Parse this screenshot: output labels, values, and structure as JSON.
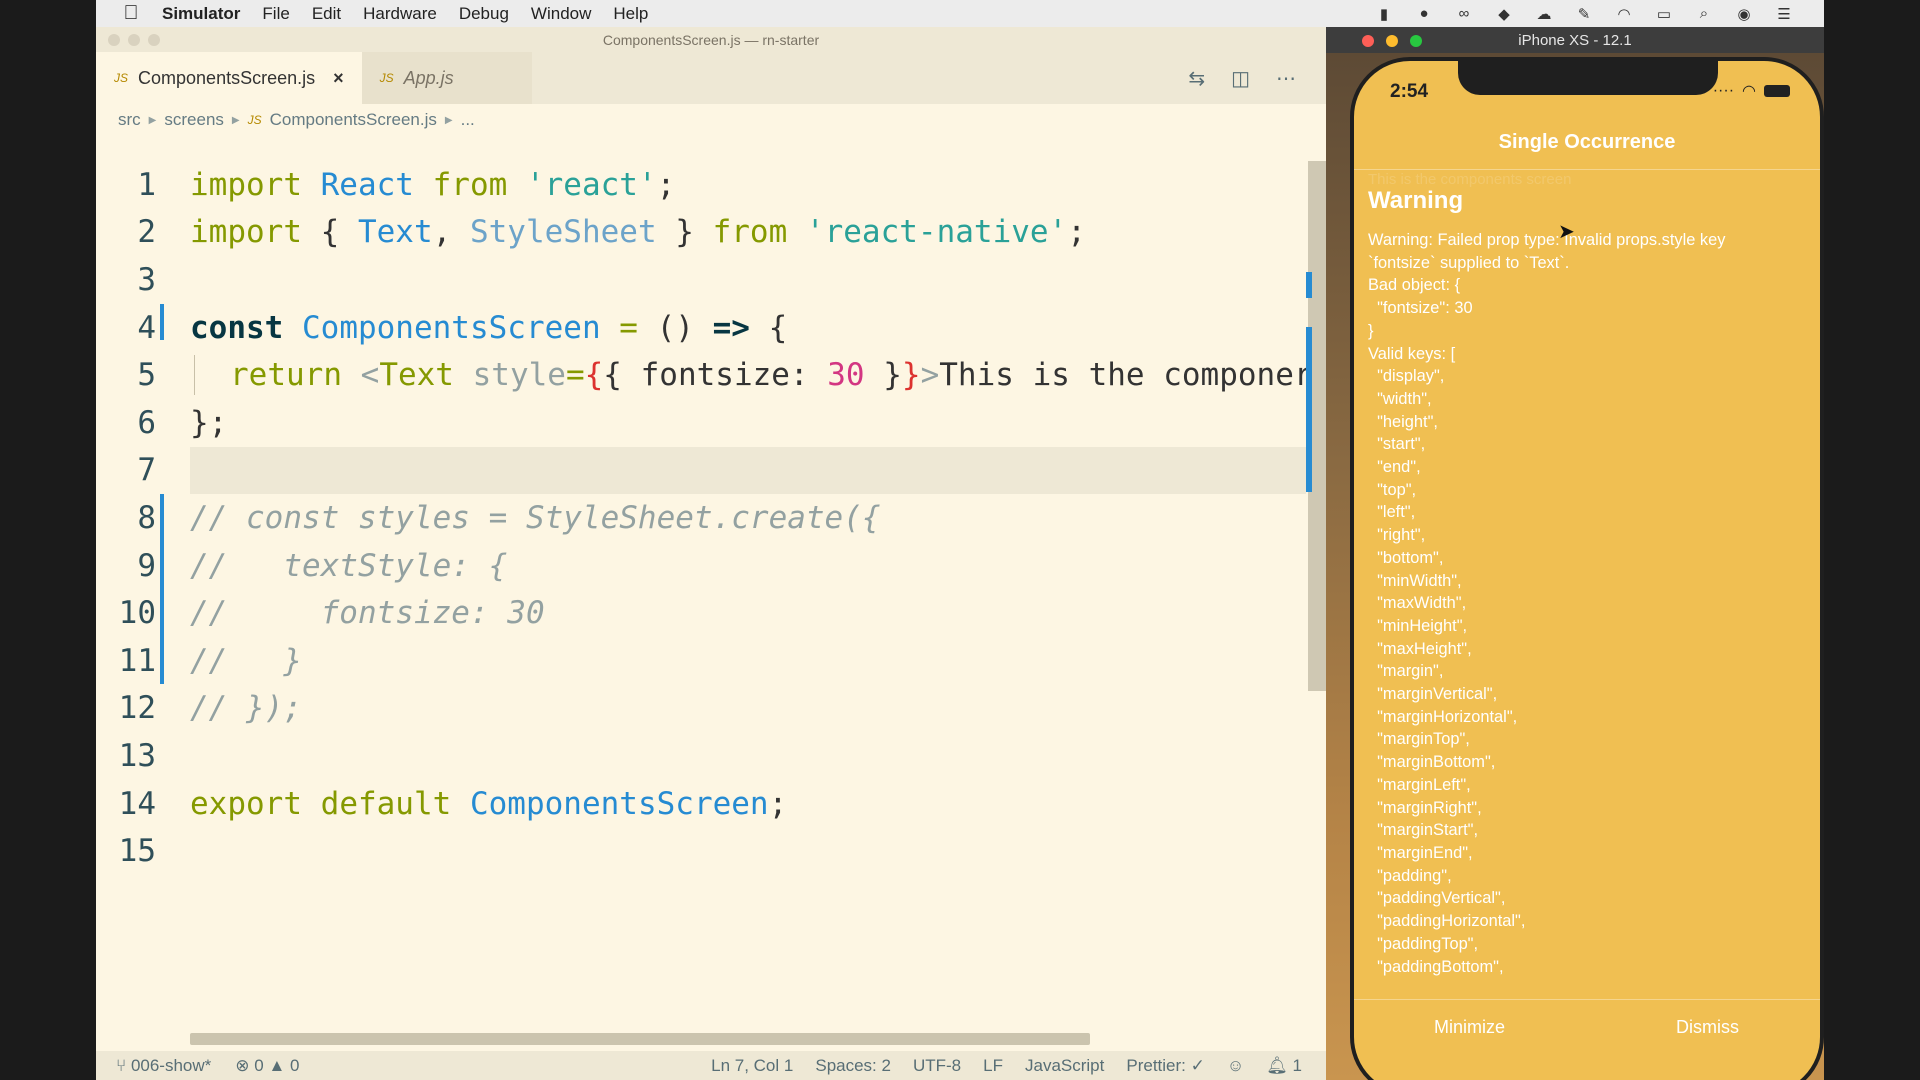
{
  "menubar": {
    "app_name": "Simulator",
    "items": [
      "File",
      "Edit",
      "Hardware",
      "Debug",
      "Window",
      "Help"
    ]
  },
  "vscode": {
    "window_title": "ComponentsScreen.js — rn-starter",
    "tabs": [
      {
        "icon": "JS",
        "label": "ComponentsScreen.js",
        "close": "×"
      },
      {
        "icon": "JS",
        "label": "App.js"
      }
    ],
    "breadcrumb": {
      "part1": "src",
      "part2": "screens",
      "icon": "JS",
      "file": "ComponentsScreen.js",
      "more": "..."
    },
    "line_numbers": [
      "1",
      "2",
      "3",
      "4",
      "5",
      "6",
      "7",
      "8",
      "9",
      "10",
      "11",
      "12",
      "13",
      "14",
      "15"
    ],
    "code": {
      "l1": {
        "a": "import",
        "b": " React ",
        "c": "from",
        "d": " 'react'",
        "e": ";"
      },
      "l2": {
        "a": "import",
        "b": " { ",
        "c": "Text",
        "d": ", ",
        "e": "StyleSheet",
        "f": " } ",
        "g": "from",
        "h": " 'react-native'",
        "i": ";"
      },
      "l4": {
        "a": "const",
        "b": " ComponentsScreen",
        "c": " = ",
        "d": "() ",
        "e": "=>",
        "f": " {"
      },
      "l5": {
        "a": "return",
        "b": " <",
        "c": "Text",
        "d": " style",
        "e": "=",
        "f": "{",
        "g": "{ fontsize: ",
        "h": "30",
        "i": " }",
        "j": "}",
        "k": ">",
        "l": "This is the componer"
      },
      "l6": "};",
      "l8": "// const styles = StyleSheet.create({",
      "l9": "//   textStyle: {",
      "l10": "//     fontsize: 30",
      "l11": "//   }",
      "l12": "// });",
      "l14": {
        "a": "export",
        "b": " ",
        "c": "default",
        "d": " ComponentsScreen",
        "e": ";"
      }
    },
    "status": {
      "branch": "006-show*",
      "errors": "0",
      "warnings": "0",
      "cursor": "Ln 7, Col 1",
      "spaces": "Spaces: 2",
      "encoding": "UTF-8",
      "eol": "LF",
      "language": "JavaScript",
      "prettier": "Prettier: ✓",
      "notifications": "1"
    }
  },
  "simulator": {
    "window_title": "iPhone XS - 12.1",
    "time": "2:54",
    "nav_title": "Single Occurrence",
    "ghost_text": "This is the components screen",
    "warning_title": "Warning",
    "warning_body": "Warning: Failed prop type: Invalid props.style key\n`fontsize` supplied to `Text`.\nBad object: {\n  \"fontsize\": 30\n}\nValid keys: [\n  \"display\",\n  \"width\",\n  \"height\",\n  \"start\",\n  \"end\",\n  \"top\",\n  \"left\",\n  \"right\",\n  \"bottom\",\n  \"minWidth\",\n  \"maxWidth\",\n  \"minHeight\",\n  \"maxHeight\",\n  \"margin\",\n  \"marginVertical\",\n  \"marginHorizontal\",\n  \"marginTop\",\n  \"marginBottom\",\n  \"marginLeft\",\n  \"marginRight\",\n  \"marginStart\",\n  \"marginEnd\",\n  \"padding\",\n  \"paddingVertical\",\n  \"paddingHorizontal\",\n  \"paddingTop\",\n  \"paddingBottom\",",
    "minimize": "Minimize",
    "dismiss": "Dismiss"
  },
  "colors": {
    "editor_bg": "#fdf6e3",
    "accent": "#268bd2",
    "redbox_bg": "#f0bf52"
  }
}
